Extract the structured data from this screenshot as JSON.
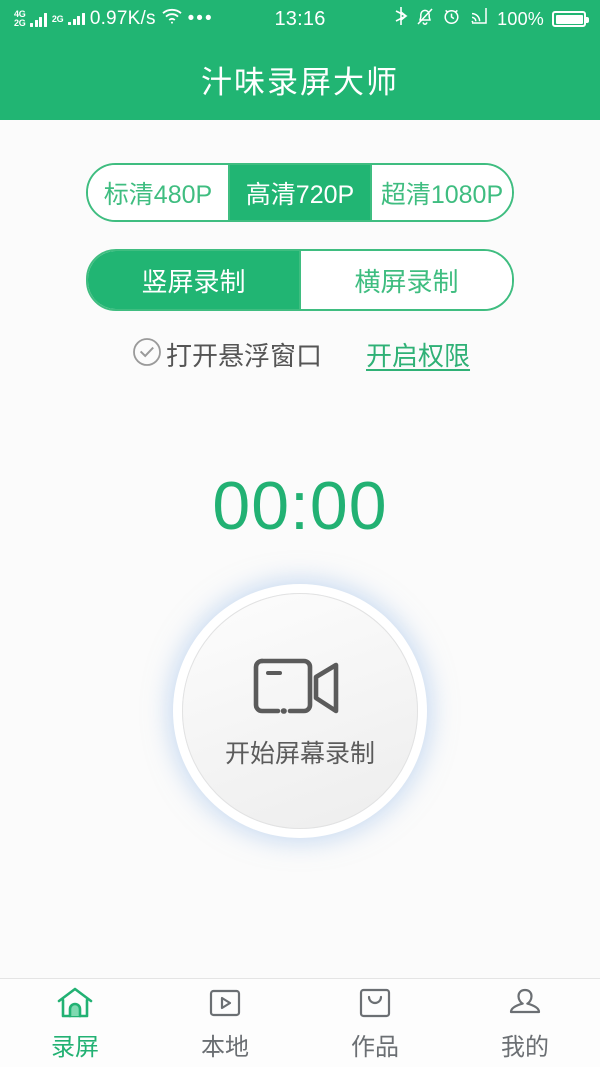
{
  "statusbar": {
    "sim1_label": "4G",
    "sim1_plus": "+",
    "sim2_label": "2G",
    "sim2_small": "2G",
    "net_speed": "0.97K/s",
    "wifi_icon": "wifi-icon",
    "overflow_icon": "more-dots-icon",
    "clock": "13:16",
    "bluetooth_icon": "bluetooth-icon",
    "mute_icon": "bell-muted-icon",
    "alarm_icon": "alarm-clock-icon",
    "cast_icon": "cast-icon",
    "battery_percent": "100%",
    "battery_icon": "battery-full-icon"
  },
  "header": {
    "title": "汁味录屏大师",
    "accent_color": "#21b573"
  },
  "quality": {
    "options": [
      {
        "label": "标清480P",
        "selected": false
      },
      {
        "label": "高清720P",
        "selected": true
      },
      {
        "label": "超清1080P",
        "selected": false
      }
    ]
  },
  "orientation": {
    "options": [
      {
        "label": "竖屏录制",
        "selected": true
      },
      {
        "label": "横屏录制",
        "selected": false
      }
    ]
  },
  "floating_window": {
    "checkbox_icon": "check-circle-icon",
    "checkbox_label": "打开悬浮窗口",
    "permission_link": "开启权限",
    "link_color": "#2fb176"
  },
  "timer": {
    "value": "00:00",
    "color": "#22b173"
  },
  "record_button": {
    "icon": "camcorder-icon",
    "label": "开始屏幕录制",
    "glow_color": "#96bae7"
  },
  "bottom_nav": {
    "items": [
      {
        "label": "录屏",
        "icon": "home-icon",
        "active": true
      },
      {
        "label": "本地",
        "icon": "video-play-icon",
        "active": false
      },
      {
        "label": "作品",
        "icon": "works-bag-icon",
        "active": false
      },
      {
        "label": "我的",
        "icon": "user-profile-icon",
        "active": false
      }
    ]
  }
}
